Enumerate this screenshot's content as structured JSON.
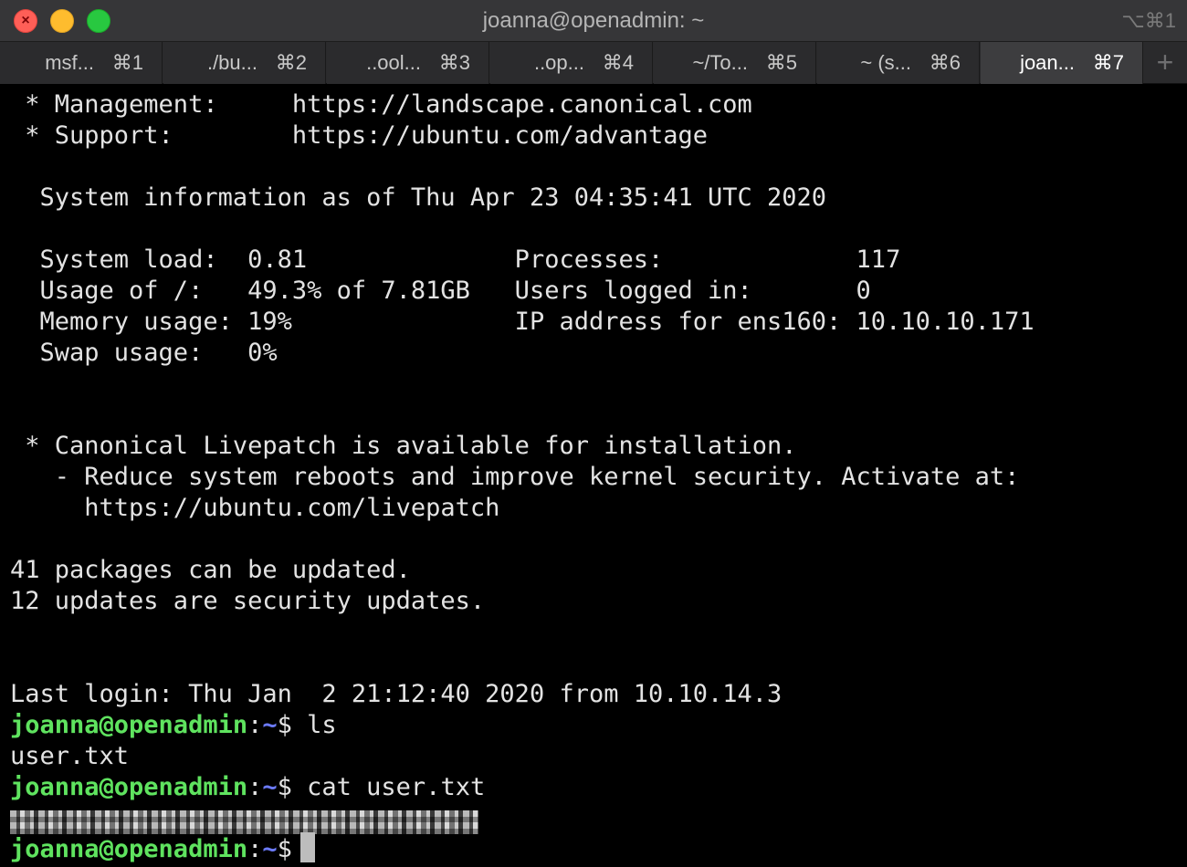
{
  "window": {
    "title": "joanna@openadmin: ~",
    "shortcut": "⌥⌘1"
  },
  "tabs": [
    {
      "label": "msf...",
      "shortcut": "⌘1"
    },
    {
      "label": "./bu...",
      "shortcut": "⌘2"
    },
    {
      "label": "..ool...",
      "shortcut": "⌘3"
    },
    {
      "label": "..op...",
      "shortcut": "⌘4"
    },
    {
      "label": "~/To...",
      "shortcut": "⌘5"
    },
    {
      "label": "~ (s...",
      "shortcut": "⌘6"
    },
    {
      "label": "joan...",
      "shortcut": "⌘7",
      "active": true
    }
  ],
  "new_tab": "+",
  "terminal": {
    "lines": [
      " * Management:     https://landscape.canonical.com",
      " * Support:        https://ubuntu.com/advantage",
      "  System information as of Thu Apr 23 04:35:41 UTC 2020",
      "  System load:  0.81              Processes:             117",
      "  Usage of /:   49.3% of 7.81GB   Users logged in:       0",
      "  Memory usage: 19%               IP address for ens160: 10.10.10.171",
      "  Swap usage:   0%",
      " * Canonical Livepatch is available for installation.",
      "   - Reduce system reboots and improve kernel security. Activate at:",
      "     https://ubuntu.com/livepatch",
      "41 packages can be updated.",
      "12 updates are security updates.",
      "Last login: Thu Jan  2 21:12:40 2020 from 10.10.14.3",
      "user.txt"
    ],
    "prompt": {
      "user_host": "joanna@openadmin",
      "colon": ":",
      "path": "~",
      "dollar": "$ "
    },
    "commands": [
      "ls",
      "cat user.txt",
      ""
    ],
    "colors": {
      "background": "#000000",
      "text": "#e3e3e3",
      "prompt_user": "#5fe35f",
      "prompt_path": "#6c7bff"
    }
  }
}
